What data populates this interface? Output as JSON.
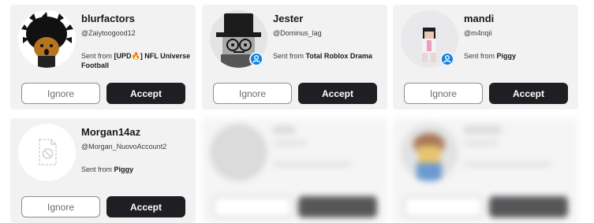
{
  "requests": [
    {
      "name": "blurfactors",
      "handle": "@Zaiytoogood12",
      "sent_prefix": "Sent from",
      "source": "[UPD🔥] NFL Universe Football",
      "avatar": "blurfactors-avatar",
      "online": false,
      "ignore_label": "Ignore",
      "accept_label": "Accept"
    },
    {
      "name": "Jester",
      "handle": "@Dominus_lag",
      "sent_prefix": "Sent from",
      "source": "Total Roblox Drama",
      "avatar": "jester-avatar",
      "online": true,
      "ignore_label": "Ignore",
      "accept_label": "Accept"
    },
    {
      "name": "mandi",
      "handle": "@m4nqii",
      "sent_prefix": "Sent from",
      "source": "Piggy",
      "avatar": "mandi-avatar",
      "online": true,
      "ignore_label": "Ignore",
      "accept_label": "Accept"
    },
    {
      "name": "Morgan14az",
      "handle": "@Morgan_NuovoAccount2",
      "sent_prefix": "Sent from",
      "source": "Piggy",
      "avatar": "placeholder-avatar",
      "online": false,
      "ignore_label": "Ignore",
      "accept_label": "Accept"
    },
    {
      "name": "",
      "handle": "",
      "sent_prefix": "",
      "source": "",
      "avatar": "blurred-avatar",
      "online": false,
      "ignore_label": "",
      "accept_label": ""
    },
    {
      "name": "",
      "handle": "",
      "sent_prefix": "",
      "source": "",
      "avatar": "blurred-avatar",
      "online": false,
      "ignore_label": "",
      "accept_label": ""
    }
  ],
  "colors": {
    "card_bg": "#f2f2f3",
    "accept_bg": "#1e1f22",
    "online_badge": "#0b83e6"
  }
}
